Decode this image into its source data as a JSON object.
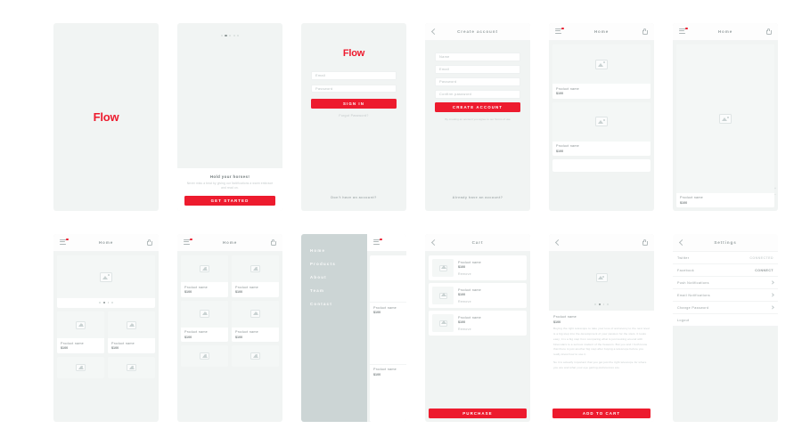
{
  "brand": {
    "name": "Flow",
    "accent": "#ed1b2e",
    "frame_bg": "#f1f4f3"
  },
  "screens": {
    "splash": {
      "logo": "Flow"
    },
    "onboarding": {
      "heading": "Hold your horses!",
      "body": "Never miss a beat by giving our Notifications a warm embrace and read on.",
      "cta": "GET STARTED",
      "dots": 5,
      "active_dot": 1
    },
    "login": {
      "logo": "Flow",
      "email_placeholder": "Email",
      "password_placeholder": "Password",
      "cta": "SIGN IN",
      "forgot": "Forgot Password?",
      "footer": "Don't have an account?"
    },
    "signup": {
      "title": "Create account",
      "fields": [
        "Name",
        "Email",
        "Password",
        "Confirm password"
      ],
      "cta": "CREATE ACCOUNT",
      "terms": "By creating an account you agree to our Terms of use",
      "footer": "Already have an account?"
    },
    "home_list": {
      "title": "Home",
      "products": [
        {
          "name": "Product name",
          "price": "$100"
        },
        {
          "name": "Product name",
          "price": "$100"
        }
      ]
    },
    "home_single": {
      "title": "Home",
      "product": {
        "name": "Product name",
        "price": "$100"
      }
    },
    "home_hero_grid": {
      "title": "Home",
      "dots": 4,
      "active_dot": 1,
      "products": [
        {
          "name": "Product name",
          "price": "$100"
        },
        {
          "name": "Product name",
          "price": "$100"
        },
        {
          "name": "",
          "price": ""
        },
        {
          "name": "",
          "price": ""
        }
      ]
    },
    "home_grid": {
      "title": "Home",
      "products": [
        {
          "name": "Product name",
          "price": "$100"
        },
        {
          "name": "Product name",
          "price": "$100"
        },
        {
          "name": "Product name",
          "price": "$100"
        },
        {
          "name": "Product name",
          "price": "$100"
        },
        {
          "name": "",
          "price": ""
        },
        {
          "name": "",
          "price": ""
        }
      ]
    },
    "drawer": {
      "items": [
        "Home",
        "Products",
        "About",
        "Team",
        "Contact"
      ],
      "peek": [
        {
          "name": "Product name",
          "price": "$100"
        },
        {
          "name": "Product name",
          "price": "$100"
        }
      ]
    },
    "cart": {
      "title": "Cart",
      "items": [
        {
          "name": "Product name",
          "price": "$100",
          "remove": "Remove"
        },
        {
          "name": "Product name",
          "price": "$100",
          "remove": "Remove"
        },
        {
          "name": "Product name",
          "price": "$100",
          "remove": "Remove"
        }
      ],
      "cta": "PURCHASE"
    },
    "detail": {
      "name": "Product name",
      "price": "$100",
      "dots": 4,
      "active_dot": 1,
      "paragraph1": "Buying the right telescope to take your love of astronomy to the next level is a big step into the development of your passion for the stars. It looks easy; it is a big step from comparing what is just looking around with binoculars to a serious student of the heavens. But you and I both know that there is just another big step after buying a telescope before you really know how to use it.",
      "paragraph2": "So it is actually important that you get just the right telescope for where you are and what your eye gazing preferences are.",
      "cta": "ADD TO CART"
    },
    "settings": {
      "title": "Settings",
      "rows": [
        {
          "label": "Twitter",
          "value": "CONNECTED",
          "type": "value-on"
        },
        {
          "label": "Facebook",
          "value": "CONNECT",
          "type": "value-off"
        },
        {
          "label": "Push Notifications",
          "value": "",
          "type": "chevron"
        },
        {
          "label": "Email Notifications",
          "value": "",
          "type": "chevron"
        },
        {
          "label": "Change Password",
          "value": "",
          "type": "chevron"
        },
        {
          "label": "Logout",
          "value": "",
          "type": "plain"
        }
      ]
    }
  }
}
